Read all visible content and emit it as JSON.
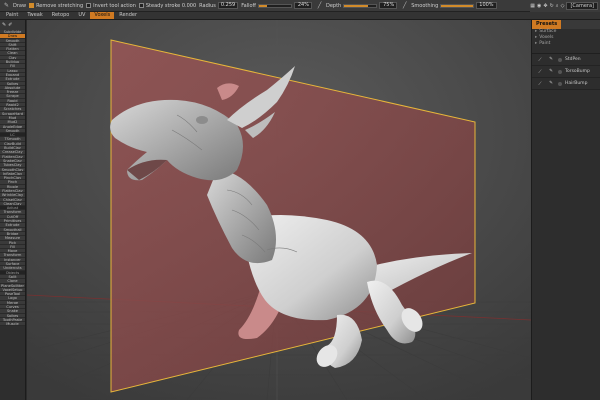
{
  "toolbar": {
    "draw_label": "Draw",
    "remove_stretching_label": "Remove stretching",
    "invert_tool_action_label": "Invert tool action",
    "steady_stroke_label": "Steady stroke 0.000",
    "radius_label": "Radius",
    "radius_value": "0.259",
    "falloff_label": "Falloff",
    "falloff_value": "24%",
    "falloff_fraction": 0.24,
    "depth_label": "Depth",
    "depth_value": "75%",
    "depth_fraction": 0.75,
    "smoothing_label": "Smoothing",
    "smoothing_value": "100%",
    "smoothing_fraction": 1.0,
    "camera_label": "[Camera]"
  },
  "rooms": [
    {
      "label": "Paint",
      "active": false
    },
    {
      "label": "Tweak",
      "active": false
    },
    {
      "label": "Retopo",
      "active": false
    },
    {
      "label": "UV",
      "active": false
    },
    {
      "label": "Voxels",
      "active": true
    },
    {
      "label": "Render",
      "active": false
    }
  ],
  "left_tools": [
    {
      "label": "Subdivide",
      "active": false
    },
    {
      "label": "Draw",
      "active": true
    },
    {
      "label": "Smooth",
      "active": false
    },
    {
      "label": "Shift",
      "active": false
    },
    {
      "label": "Flatten",
      "active": false
    },
    {
      "label": "Clean",
      "active": false
    },
    {
      "label": "Clay",
      "active": false
    },
    {
      "label": "Buildup",
      "active": false
    },
    {
      "label": "Fill",
      "active": false
    },
    {
      "label": "Lasso",
      "active": false
    },
    {
      "label": "Expand",
      "active": false
    },
    {
      "label": "Extrude",
      "active": false
    },
    {
      "label": "Spikes",
      "active": false
    },
    {
      "label": "Absolute",
      "active": false
    },
    {
      "label": "Freeze",
      "active": false
    },
    {
      "label": "Scrape",
      "active": false
    },
    {
      "label": "Rapid",
      "active": false
    },
    {
      "label": "Rapid2",
      "active": false
    },
    {
      "label": "Scratches",
      "active": false
    },
    {
      "label": "ScrapeHard",
      "active": false
    },
    {
      "label": "Mud",
      "active": false
    },
    {
      "label": "Mud2",
      "active": false
    },
    {
      "label": "AngleEdge",
      "active": false
    },
    {
      "label": "Smooth",
      "active": false
    },
    {
      "label": "LC",
      "active": false,
      "header": true
    },
    {
      "label": "TSmooth",
      "active": false
    },
    {
      "label": "ClayBuild",
      "active": false
    },
    {
      "label": "BuildClay",
      "active": false
    },
    {
      "label": "CreaseClay",
      "active": false
    },
    {
      "label": "FlattenClay",
      "active": false
    },
    {
      "label": "SnakeClay",
      "active": false
    },
    {
      "label": "TubesClay",
      "active": false
    },
    {
      "label": "SmoothClay",
      "active": false
    },
    {
      "label": "InflateClay",
      "active": false
    },
    {
      "label": "PinchClay",
      "active": false
    },
    {
      "label": "Pinch",
      "active": false
    },
    {
      "label": "Ripple",
      "active": false
    },
    {
      "label": "FlattenClay",
      "active": false
    },
    {
      "label": "WrinkleClay",
      "active": false
    },
    {
      "label": "ChiselClay",
      "active": false
    },
    {
      "label": "CleanClay",
      "active": false
    },
    {
      "label": "Adjust",
      "active": false,
      "header": true
    },
    {
      "label": "Transform",
      "active": false
    },
    {
      "label": "CutOff",
      "active": false
    },
    {
      "label": "Primitives",
      "active": false
    },
    {
      "label": "Extrude",
      "active": false
    },
    {
      "label": "Smoothall",
      "active": false
    },
    {
      "label": "Bridge",
      "active": false
    },
    {
      "label": "Measure",
      "active": false
    },
    {
      "label": "Pick",
      "active": false
    },
    {
      "label": "Fill",
      "active": false
    },
    {
      "label": "Move",
      "active": false
    },
    {
      "label": "Transform",
      "active": false
    },
    {
      "label": "Instancer",
      "active": false
    },
    {
      "label": "Surface",
      "active": false
    },
    {
      "label": "Undercuts",
      "active": false
    },
    {
      "label": "Objects",
      "active": false,
      "header": true
    },
    {
      "label": "Split",
      "active": false
    },
    {
      "label": "Clone",
      "active": false
    },
    {
      "label": "PlaneSplitter",
      "active": false
    },
    {
      "label": "VoxelSetup",
      "active": false
    },
    {
      "label": "PoseTool",
      "active": false
    },
    {
      "label": "Logo",
      "active": false
    },
    {
      "label": "Merge",
      "active": false
    },
    {
      "label": "Curves",
      "active": false
    },
    {
      "label": "Snake",
      "active": false
    },
    {
      "label": "Spikes",
      "active": false
    },
    {
      "label": "ToothPaste",
      "active": false
    },
    {
      "label": "Muscle",
      "active": false
    }
  ],
  "right_panel": {
    "tab_label": "Presets",
    "tree": [
      "Surface",
      "Voxels",
      "Paint"
    ],
    "layers": [
      "StdPen",
      "TorsoBump",
      "HairBump"
    ]
  },
  "colors": {
    "accent": "#d07a22",
    "clip_plane_fill": "#8a4a4a",
    "clip_plane_border": "#e7b63a",
    "model": "#d9d9d9",
    "model_highlight": "#c98a8a"
  }
}
